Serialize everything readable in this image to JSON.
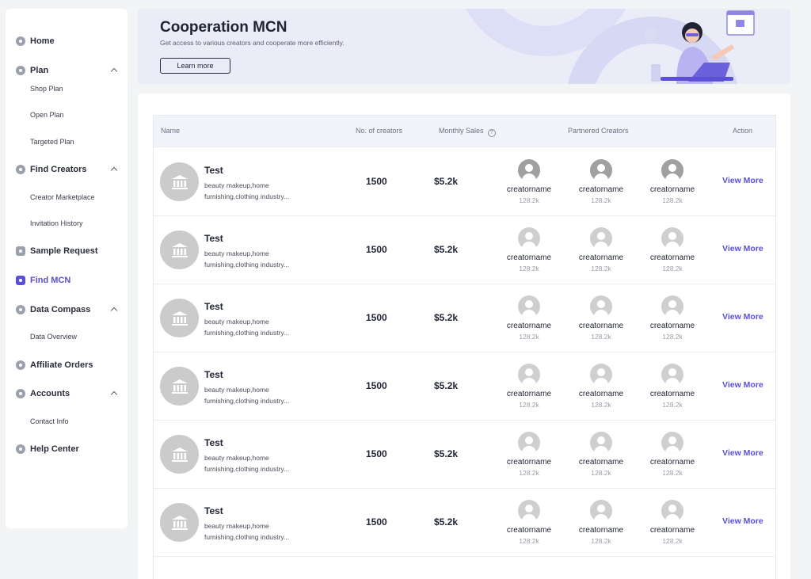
{
  "sidebar": {
    "home": "Home",
    "plan": "Plan",
    "plan_items": [
      "Shop Plan",
      "Open Plan",
      "Targeted Plan"
    ],
    "find_creators": "Find Creators",
    "find_creators_items": [
      "Creator Marketplace",
      "Invitation History"
    ],
    "sample_request": "Sample Request",
    "find_mcn": "Find MCN",
    "data_compass": "Data Compass",
    "data_compass_items": [
      "Data Overview"
    ],
    "affiliate_orders": "Affiliate Orders",
    "accounts": "Accounts",
    "accounts_items": [
      "Contact Info"
    ],
    "help_center": "Help Center"
  },
  "banner": {
    "title": "Cooperation MCN",
    "subtitle": "Get access to various creators and cooperate more efficiently.",
    "learn_more": "Learn more"
  },
  "table": {
    "headers": {
      "name": "Name",
      "creators": "No. of creators",
      "sales": "Monthly Sales",
      "partnered": "Partnered Creators",
      "action": "Action"
    },
    "rows": [
      {
        "name": "Test",
        "tags": "beauty makeup,home furnishing,clothing industry...",
        "count": "1500",
        "sales": "$5.2k",
        "creators": [
          {
            "name": "creatorname",
            "followers": "128.2k"
          },
          {
            "name": "creatorname",
            "followers": "128.2k"
          },
          {
            "name": "creatorname",
            "followers": "128.2k"
          }
        ],
        "action": "View More"
      },
      {
        "name": "Test",
        "tags": "beauty makeup,home furnishing,clothing industry...",
        "count": "1500",
        "sales": "$5.2k",
        "creators": [
          {
            "name": "creatorname",
            "followers": "128.2k"
          },
          {
            "name": "creatorname",
            "followers": "128.2k"
          },
          {
            "name": "creatorname",
            "followers": "128.2k"
          }
        ],
        "action": "View More"
      },
      {
        "name": "Test",
        "tags": "beauty makeup,home furnishing,clothing industry...",
        "count": "1500",
        "sales": "$5.2k",
        "creators": [
          {
            "name": "creatorname",
            "followers": "128.2k"
          },
          {
            "name": "creatorname",
            "followers": "128.2k"
          },
          {
            "name": "creatorname",
            "followers": "128.2k"
          }
        ],
        "action": "View More"
      },
      {
        "name": "Test",
        "tags": "beauty makeup,home furnishing,clothing industry...",
        "count": "1500",
        "sales": "$5.2k",
        "creators": [
          {
            "name": "creatorname",
            "followers": "128.2k"
          },
          {
            "name": "creatorname",
            "followers": "128.2k"
          },
          {
            "name": "creatorname",
            "followers": "128.2k"
          }
        ],
        "action": "View More"
      },
      {
        "name": "Test",
        "tags": "beauty makeup,home furnishing,clothing industry...",
        "count": "1500",
        "sales": "$5.2k",
        "creators": [
          {
            "name": "creatorname",
            "followers": "128.2k"
          },
          {
            "name": "creatorname",
            "followers": "128.2k"
          },
          {
            "name": "creatorname",
            "followers": "128.2k"
          }
        ],
        "action": "View More"
      },
      {
        "name": "Test",
        "tags": "beauty makeup,home furnishing,clothing industry...",
        "count": "1500",
        "sales": "$5.2k",
        "creators": [
          {
            "name": "creatorname",
            "followers": "128.2k"
          },
          {
            "name": "creatorname",
            "followers": "128.2k"
          },
          {
            "name": "creatorname",
            "followers": "128.2k"
          }
        ],
        "action": "View More"
      }
    ]
  },
  "colors": {
    "accent": "#5b4fd6",
    "avatar": "#cbcbcb"
  },
  "icons": [
    "home-icon",
    "plan-icon",
    "find-creators-icon",
    "sample-request-icon",
    "find-mcn-icon",
    "data-compass-icon",
    "affiliate-orders-icon",
    "accounts-icon",
    "help-center-icon",
    "info-icon",
    "bank-icon",
    "user-avatar-icon"
  ]
}
